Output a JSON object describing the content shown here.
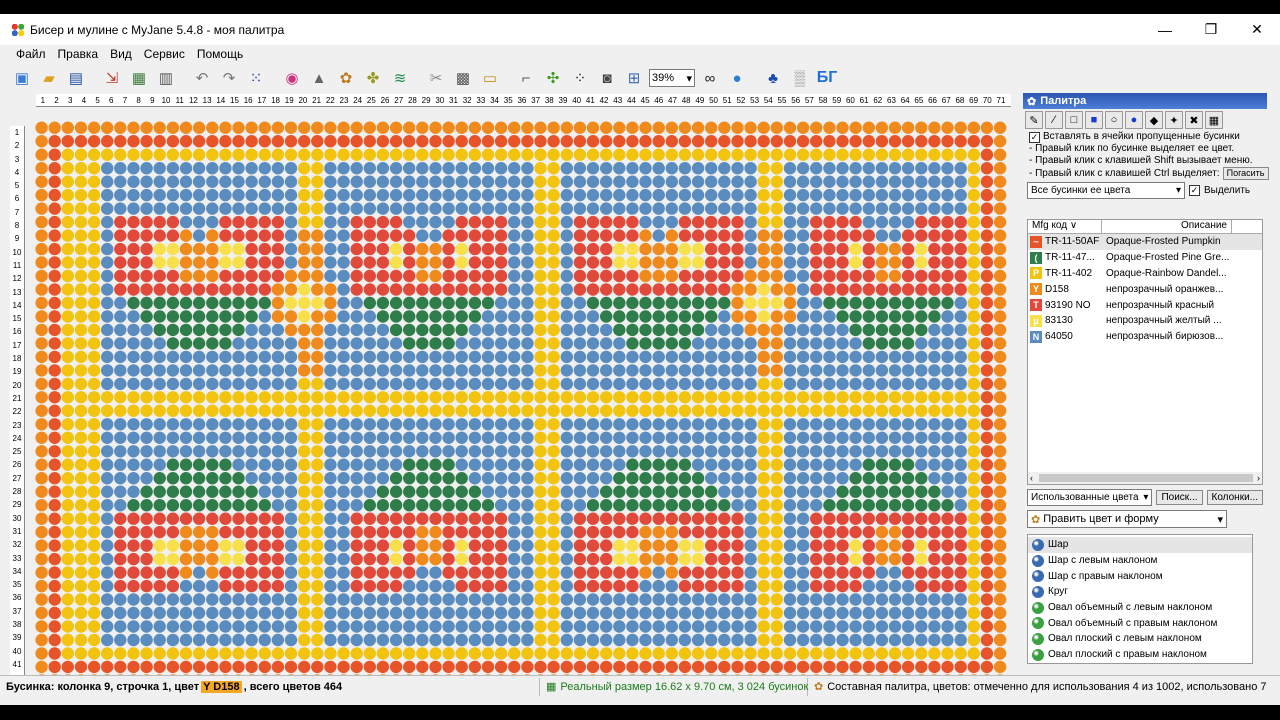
{
  "window": {
    "title": "Бисер и мулине с MyJane 5.4.8 - моя палитра",
    "min": "—",
    "restore": "❐",
    "close": "✕"
  },
  "menu": [
    "Файл",
    "Правка",
    "Вид",
    "Сервис",
    "Помощь"
  ],
  "toolbar": {
    "zoom": "39%",
    "logo": "БГ"
  },
  "ruler": {
    "max": 71
  },
  "ruler_left": {
    "max": 41
  },
  "palette": {
    "title": "Палитра",
    "checkbox_label": "Вставлять в ячейки пропущенные бусинки",
    "hints": [
      "- Правый клик по бусинке выделяет ее цвет.",
      "- Правый клик с клавишей Shift вызывает меню.",
      "- Правый клик с клавишей Ctrl выделяет:"
    ],
    "hide_button": "Погасить",
    "filter_select": "Все бусинки ее цвета",
    "select_label": "Выделить",
    "col_code": "Mfg код ∨",
    "col_desc": "Описание",
    "rows": [
      {
        "mark": "~",
        "code": "TR-11-50AF",
        "desc": "Opaque-Frosted Pumpkin",
        "color": "#e8542a"
      },
      {
        "mark": "(",
        "code": "TR-11-47...",
        "desc": "Opaque-Frosted Pine Gre...",
        "color": "#2e7d4a"
      },
      {
        "mark": "P",
        "code": "TR-11-402",
        "desc": "Opaque-Rainbow Dandel...",
        "color": "#f2c30f"
      },
      {
        "mark": "Y",
        "code": "D158",
        "desc": "непрозрачный оранжев...",
        "color": "#f08a1c"
      },
      {
        "mark": "T",
        "code": "93190 NO",
        "desc": "непрозрачный красный",
        "color": "#e14a3a"
      },
      {
        "mark": "μ",
        "code": "83130",
        "desc": "непрозрачный желтый ...",
        "color": "#f7e04a"
      },
      {
        "mark": "N",
        "code": "64050",
        "desc": "непрозрачный бирюзов...",
        "color": "#5a8cc0"
      }
    ],
    "used_select": "Использованные цвета",
    "search_button": "Поиск...",
    "columns_button": "Колонки..."
  },
  "shape_panel": {
    "title": "Править цвет и форму",
    "items": [
      "Шар",
      "Шар с левым наклоном",
      "Шар с правым наклоном",
      "Круг",
      "Овал объемный с левым наклоном",
      "Овал объемный с правым наклоном",
      "Овал плоский с левым наклоном",
      "Овал плоский с правым наклоном"
    ]
  },
  "status": {
    "bead_prefix": "Бусинка: колонка 9, строчка 1, цвет",
    "bead_color": "Y D158",
    "bead_suffix": ", всего цветов 464",
    "real_size": "Реальный размер 16.62 x 9.70 см, 3 024 бусинок",
    "palette_info": "Составная палитра, цветов: отмеченно для использования 4 из 1002, использовано 7"
  }
}
